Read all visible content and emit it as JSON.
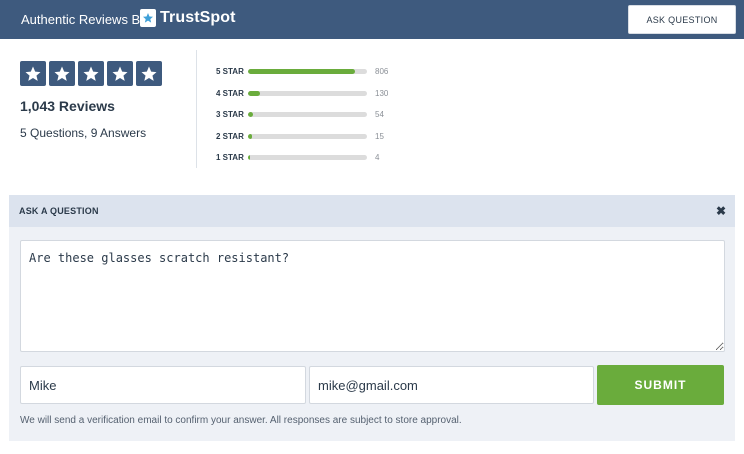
{
  "header": {
    "brand_prefix": "Authentic Reviews By",
    "logo_name": "TrustSpot",
    "ask_button_label": "ASK QUESTION",
    "bar_color": "#3e5a7e"
  },
  "summary": {
    "rating_stars": 5,
    "reviews_label": "1,043 Reviews",
    "qa_label": "5 Questions, 9 Answers"
  },
  "histogram": [
    {
      "label": "5 STAR",
      "count": "806",
      "fraction": 0.9
    },
    {
      "label": "4 STAR",
      "count": "130",
      "fraction": 0.1
    },
    {
      "label": "3 STAR",
      "count": "54",
      "fraction": 0.045
    },
    {
      "label": "2 STAR",
      "count": "15",
      "fraction": 0.03
    },
    {
      "label": "1 STAR",
      "count": "4",
      "fraction": 0.01
    }
  ],
  "ask_panel": {
    "title": "ASK A QUESTION",
    "close_icon": "close-icon",
    "question_value": "Are these glasses scratch resistant?",
    "name_value": "Mike",
    "email_value": "mike@gmail.com",
    "submit_label": "SUBMIT",
    "notice": "We will send a verification email to confirm your answer. All responses are subject to store approval."
  },
  "colors": {
    "accent_green": "#6aac3c",
    "panel_bg": "#eef1f6"
  }
}
